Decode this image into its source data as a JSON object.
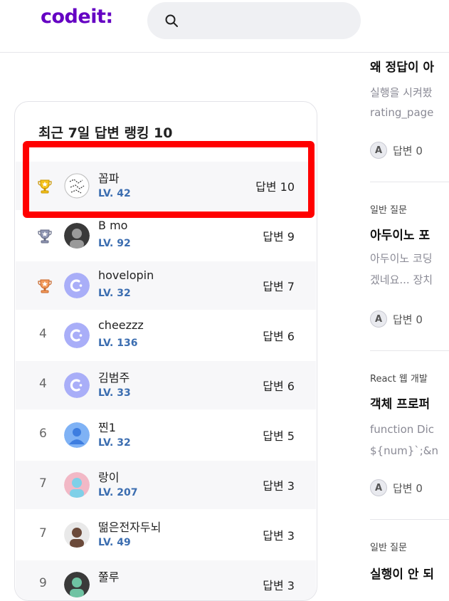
{
  "header": {
    "logo": "codeit:"
  },
  "ranking": {
    "title": "최근 7일 답변 랭킹 10",
    "rows": [
      {
        "rank": "1",
        "medal": "gold",
        "name": "꼽파",
        "level": "LV. 42",
        "answers": "답변 10",
        "avatar": "pattern-avatar"
      },
      {
        "rank": "2",
        "medal": "silver",
        "name": "B mo",
        "level": "LV. 92",
        "answers": "답변 9",
        "avatar": "photo-avatar"
      },
      {
        "rank": "3",
        "medal": "bronze",
        "name": "hovelopin",
        "level": "LV. 32",
        "answers": "답변 7",
        "avatar": "codeit-default-avatar"
      },
      {
        "rank": "4",
        "medal": "",
        "name": "cheezzz",
        "level": "LV. 136",
        "answers": "답변 6",
        "avatar": "codeit-default-avatar"
      },
      {
        "rank": "4",
        "medal": "",
        "name": "김범주",
        "level": "LV. 33",
        "answers": "답변 6",
        "avatar": "codeit-default-avatar"
      },
      {
        "rank": "6",
        "medal": "",
        "name": "찐1",
        "level": "LV. 32",
        "answers": "답변 5",
        "avatar": "person-silhouette-avatar"
      },
      {
        "rank": "7",
        "medal": "",
        "name": "랑이",
        "level": "LV. 207",
        "answers": "답변 3",
        "avatar": "photo-avatar"
      },
      {
        "rank": "7",
        "medal": "",
        "name": "떪은전자두뇌",
        "level": "LV. 49",
        "answers": "답변 3",
        "avatar": "photo-avatar"
      },
      {
        "rank": "9",
        "medal": "",
        "name": "쭐루",
        "level": "",
        "answers": "답변 3",
        "avatar": "photo-avatar"
      }
    ]
  },
  "posts": [
    {
      "category": "",
      "title": "왜 정답이 아",
      "body": [
        "실행을 시켜봤",
        "rating_page"
      ],
      "answers": "답변 0"
    },
    {
      "category": "일반 질문",
      "title": "아두이노 포",
      "body": [
        "아두이노 코딩",
        "겠네요... 장치"
      ],
      "answers": "답변 0"
    },
    {
      "category": "React 웹 개발",
      "title": "객체 프로퍼",
      "body": [
        "function Dic",
        "${num}`;&n"
      ],
      "answers": "답변 0"
    },
    {
      "category": "일반 질문",
      "title": "실행이 안 되",
      "body": [],
      "answers": ""
    }
  ],
  "colors": {
    "brand": "#6500c3",
    "level": "#3b6db0",
    "highlight": "#ff0000"
  }
}
